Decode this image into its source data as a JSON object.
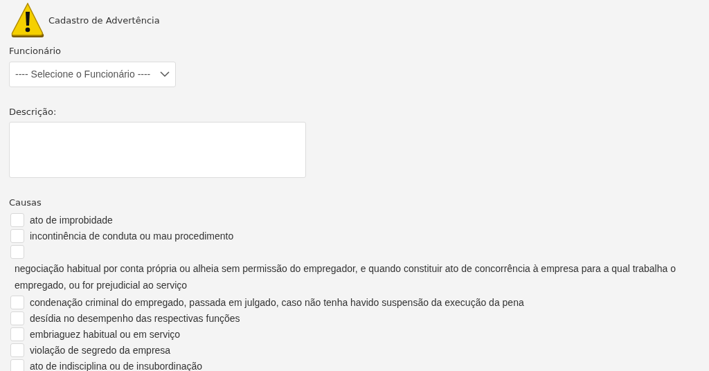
{
  "header": {
    "title": "Cadastro de Advertência"
  },
  "employee": {
    "label": "Funcionário",
    "value": "---- Selecione o Funcionário ----"
  },
  "description": {
    "label": "Descrição:"
  },
  "causes": {
    "label": "Causas",
    "items": [
      {
        "kind": "inline",
        "label": "ato de improbidade",
        "checked": false
      },
      {
        "kind": "inline",
        "label": "incontinência de conduta ou mau procedimento",
        "checked": false
      },
      {
        "kind": "block",
        "label": "negociação habitual por conta própria ou alheia sem permissão do empregador, e quando constituir ato de concorrência à empresa para a qual trabalha o empregado, ou for prejudicial ao serviço",
        "checked": false
      },
      {
        "kind": "inline",
        "label": "condenação criminal do empregado, passada em julgado, caso não tenha havido suspensão da execução da pena",
        "checked": false
      },
      {
        "kind": "inline",
        "label": "desídia no desempenho das respectivas funções",
        "checked": false
      },
      {
        "kind": "inline",
        "label": "embriaguez habitual ou em serviço",
        "checked": false
      },
      {
        "kind": "inline",
        "label": "violação de segredo da empresa",
        "checked": false
      },
      {
        "kind": "inline",
        "label": "ato de indisciplina ou de insubordinação",
        "checked": false
      }
    ]
  }
}
